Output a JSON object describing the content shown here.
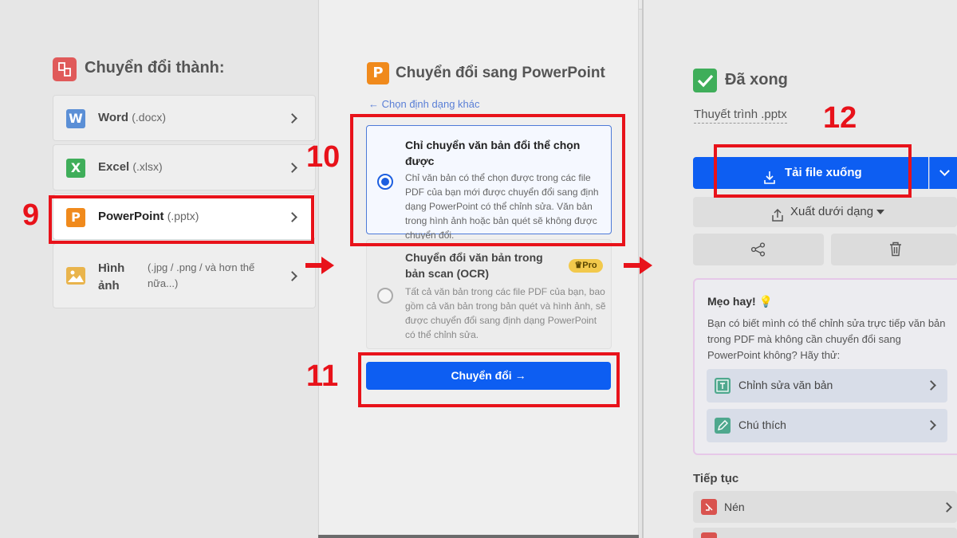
{
  "left_panel": {
    "title": "Chuyển đổi thành:",
    "formats": [
      {
        "name": "Word",
        "ext": "(.docx)",
        "icon": "W",
        "color": "#5b8fd6"
      },
      {
        "name": "Excel",
        "ext": "(.xlsx)",
        "icon": "X",
        "color": "#3fae5a"
      },
      {
        "name": "PowerPoint",
        "ext": "(.pptx)",
        "icon": "P",
        "color": "#f08a1c"
      },
      {
        "name": "Hình ảnh",
        "ext": "(.jpg / .png / và hơn thế nữa...)",
        "icon": "image",
        "color": "#e9b44c"
      }
    ]
  },
  "middle_panel": {
    "title": "Chuyển đổi sang PowerPoint",
    "back_link": "Chọn định dạng khác",
    "options": [
      {
        "title": "Chỉ chuyển văn bản đổi thể chọn được",
        "desc": "Chỉ văn bản có thể chọn được trong các file PDF của bạn mới được chuyển đổi sang định dạng PowerPoint có thể chỉnh sửa. Văn bản trong hình ảnh hoặc bản quét sẽ không được chuyển đổi.",
        "selected": true
      },
      {
        "title": "Chuyển đổi văn bản trong bản scan (OCR)",
        "badge": "Pro",
        "desc": "Tất cả văn bản trong các file PDF của bạn, bao gồm cả văn bản trong bản quét và hình ảnh, sẽ được chuyển đổi sang định dạng PowerPoint có thể chỉnh sửa.",
        "selected": false
      }
    ],
    "convert_button": "Chuyển đổi",
    "convert_arrow": "→"
  },
  "right_panel": {
    "done_title": "Đã xong",
    "file_name": "Thuyết trình .pptx",
    "download_button": "Tải file xuống",
    "export_button": "Xuất dưới dạng",
    "tip": {
      "title": "Mẹo hay!",
      "text": "Bạn có biết mình có thể chỉnh sửa trực tiếp văn bản trong PDF mà không cần chuyển đổi sang PowerPoint không? Hãy thử:",
      "items": [
        "Chỉnh sửa văn bản",
        "Chú thích"
      ]
    },
    "continue_title": "Tiếp tục",
    "continue_items": [
      "Nén"
    ]
  },
  "annotations": {
    "step9": "9",
    "step10": "10",
    "step11": "11",
    "step12": "12"
  },
  "colors": {
    "primary_blue": "#0d5ef2",
    "annotation_red": "#e8121a",
    "done_green": "#3fae5a"
  }
}
